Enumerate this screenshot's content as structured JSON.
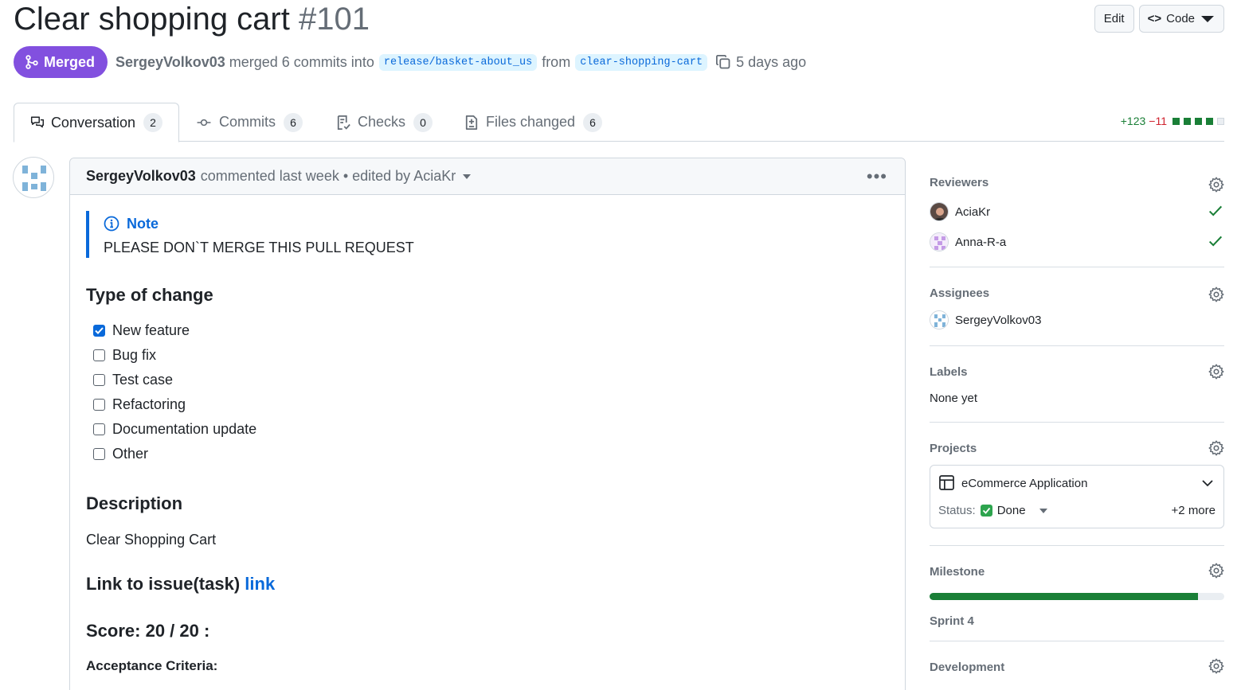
{
  "pr": {
    "title": "Clear shopping cart",
    "number": "#101",
    "status": "Merged",
    "author": "SergeyVolkov03",
    "merged_text": "merged 6 commits into",
    "base_branch": "release/basket-about_us",
    "from_text": "from",
    "head_branch": "clear-shopping-cart",
    "time": "5 days ago"
  },
  "actions": {
    "edit": "Edit",
    "code": "Code"
  },
  "tabs": [
    {
      "label": "Conversation",
      "count": "2"
    },
    {
      "label": "Commits",
      "count": "6"
    },
    {
      "label": "Checks",
      "count": "0"
    },
    {
      "label": "Files changed",
      "count": "6"
    }
  ],
  "diffstat": {
    "additions": "+123",
    "deletions": "−11"
  },
  "comment": {
    "author": "SergeyVolkov03",
    "meta": "commented last week • edited by AciaKr",
    "note_title": "Note",
    "note_text": "PLEASE DON`T MERGE THIS PULL REQUEST",
    "type_heading": "Type of change",
    "tasks": [
      {
        "label": "New feature",
        "checked": true
      },
      {
        "label": "Bug fix",
        "checked": false
      },
      {
        "label": "Test case",
        "checked": false
      },
      {
        "label": "Refactoring",
        "checked": false
      },
      {
        "label": "Documentation update",
        "checked": false
      },
      {
        "label": "Other",
        "checked": false
      }
    ],
    "desc_heading": "Description",
    "desc_text": "Clear Shopping Cart",
    "issue_heading": "Link to issue(task)",
    "issue_link": "link",
    "score": "Score: 20 / 20 :",
    "acceptance": "Acceptance Criteria:"
  },
  "sidebar": {
    "reviewers_label": "Reviewers",
    "reviewers": [
      "AciaKr",
      "Anna-R-a"
    ],
    "assignees_label": "Assignees",
    "assignee": "SergeyVolkov03",
    "labels_label": "Labels",
    "labels_value": "None yet",
    "projects_label": "Projects",
    "project_name": "eCommerce Application",
    "status_label": "Status:",
    "status_value": "Done",
    "more": "+2 more",
    "milestone_label": "Milestone",
    "milestone_progress": 0.91,
    "milestone_name": "Sprint 4",
    "development_label": "Development"
  },
  "colors": {
    "merged": "#8250df",
    "link": "#0969da",
    "success": "#1a7f37",
    "danger": "#cf222e"
  }
}
